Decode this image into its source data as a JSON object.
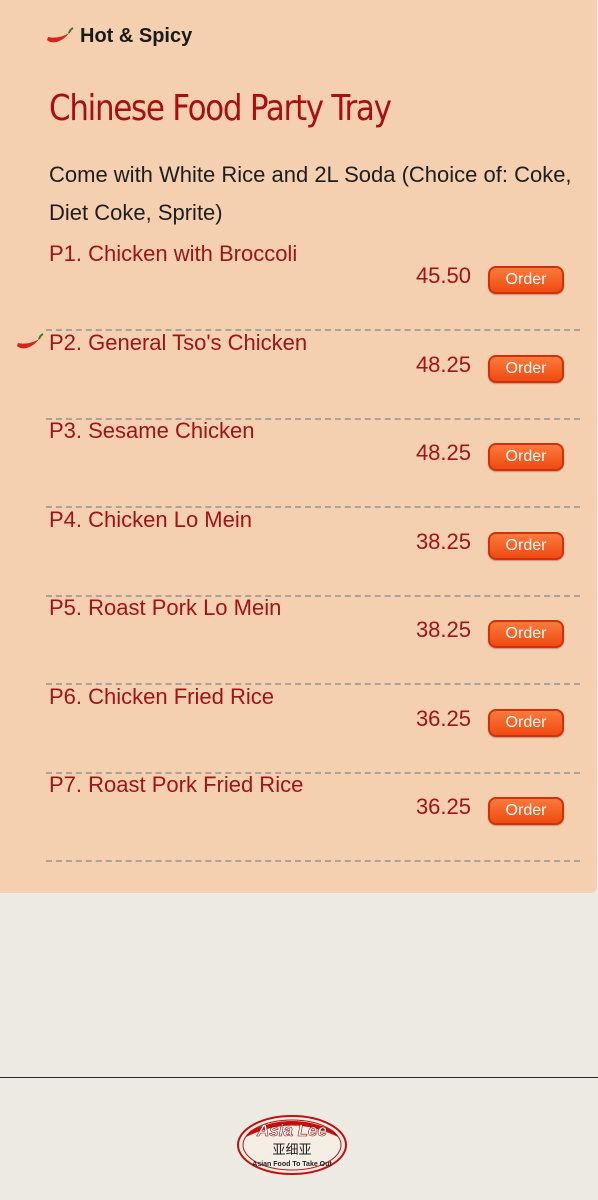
{
  "legend": {
    "icon": "chili-pepper-icon",
    "label": "Hot & Spicy"
  },
  "section": {
    "title": "Chinese Food Party Tray",
    "description": "Come with White Rice and 2L Soda (Choice of: Coke, Diet Coke, Sprite)"
  },
  "order_label": "Order",
  "items": [
    {
      "name": "P1. Chicken with Broccoli",
      "price": "45.50",
      "spicy": false
    },
    {
      "name": "P2. General Tso's Chicken",
      "price": "48.25",
      "spicy": true
    },
    {
      "name": "P3. Sesame Chicken",
      "price": "48.25",
      "spicy": false
    },
    {
      "name": "P4. Chicken Lo Mein",
      "price": "38.25",
      "spicy": false
    },
    {
      "name": "P5. Roast Pork Lo Mein",
      "price": "38.25",
      "spicy": false
    },
    {
      "name": "P6. Chicken Fried Rice",
      "price": "36.25",
      "spicy": false
    },
    {
      "name": "P7. Roast Pork Fried Rice",
      "price": "36.25",
      "spicy": false
    }
  ],
  "logo": {
    "name": "Asia Lee",
    "chinese": "亚细亚",
    "tagline": "Asian Food To Take Out"
  },
  "colors": {
    "panel": "#f4cfb0",
    "item_text": "#a01418",
    "title": "#a81010",
    "order_button": "#f05a1e",
    "page_bg": "#eceae3"
  }
}
